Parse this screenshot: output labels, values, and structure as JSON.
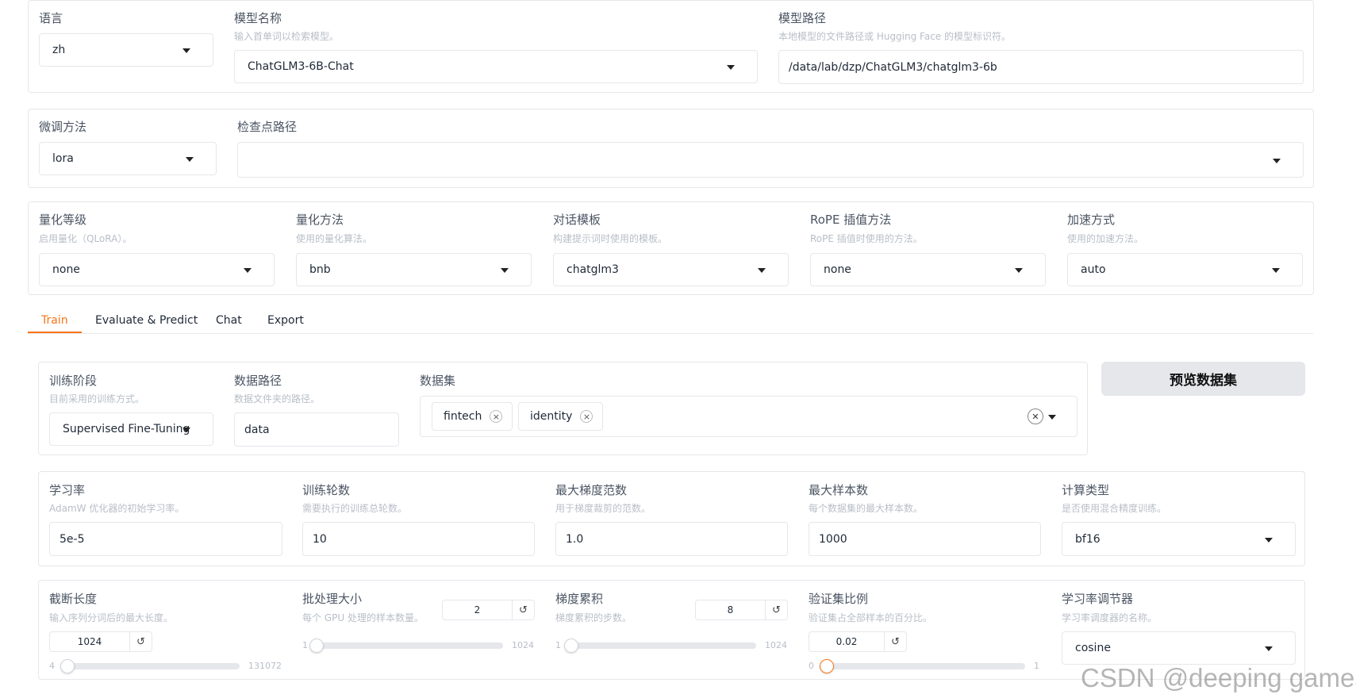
{
  "top": {
    "lang": {
      "label": "语言",
      "value": "zh"
    },
    "model_name": {
      "label": "模型名称",
      "info": "输入首单词以检索模型。",
      "value": "ChatGLM3-6B-Chat"
    },
    "model_path": {
      "label": "模型路径",
      "info": "本地模型的文件路径或 Hugging Face 的模型标识符。",
      "value": "/data/lab/dzp/ChatGLM3/chatglm3-6b"
    }
  },
  "finetune": {
    "method": {
      "label": "微调方法",
      "value": "lora"
    },
    "checkpoint": {
      "label": "检查点路径",
      "value": ""
    }
  },
  "advanced": {
    "quant_bit": {
      "label": "量化等级",
      "info": "启用量化（QLoRA）。",
      "value": "none"
    },
    "quant_method": {
      "label": "量化方法",
      "info": "使用的量化算法。",
      "value": "bnb"
    },
    "template": {
      "label": "对话模板",
      "info": "构建提示词时使用的模板。",
      "value": "chatglm3"
    },
    "rope": {
      "label": "RoPE 插值方法",
      "info": "RoPE 插值时使用的方法。",
      "value": "none"
    },
    "booster": {
      "label": "加速方式",
      "info": "使用的加速方法。",
      "value": "auto"
    }
  },
  "tabs": [
    "Train",
    "Evaluate & Predict",
    "Chat",
    "Export"
  ],
  "active_tab": "Train",
  "accent_color": "#f97316",
  "train": {
    "stage": {
      "label": "训练阶段",
      "info": "目前采用的训练方式。",
      "value": "Supervised Fine-Tuning"
    },
    "dataset_dir": {
      "label": "数据路径",
      "info": "数据文件夹的路径。",
      "value": "data"
    },
    "dataset": {
      "label": "数据集",
      "chips": [
        "fintech",
        "identity"
      ]
    },
    "preview_button": "预览数据集",
    "learning_rate": {
      "label": "学习率",
      "info": "AdamW 优化器的初始学习率。",
      "value": "5e-5"
    },
    "epochs": {
      "label": "训练轮数",
      "info": "需要执行的训练总轮数。",
      "value": "10"
    },
    "max_grad_norm": {
      "label": "最大梯度范数",
      "info": "用于梯度裁剪的范数。",
      "value": "1.0"
    },
    "max_samples": {
      "label": "最大样本数",
      "info": "每个数据集的最大样本数。",
      "value": "1000"
    },
    "compute_type": {
      "label": "计算类型",
      "info": "是否使用混合精度训练。",
      "value": "bf16"
    },
    "cutoff_len": {
      "label": "截断长度",
      "info": "输入序列分词后的最大长度。",
      "value": "1024",
      "min": "4",
      "max": "131072",
      "fraction": 0.008
    },
    "batch_size": {
      "label": "批处理大小",
      "info": "每个 GPU 处理的样本数量。",
      "value": "2",
      "min": "1",
      "max": "1024",
      "fraction": 0.001
    },
    "grad_accum": {
      "label": "梯度累积",
      "info": "梯度累积的步数。",
      "value": "8",
      "min": "1",
      "max": "1024",
      "fraction": 0.007
    },
    "val_size": {
      "label": "验证集比例",
      "info": "验证集占全部样本的百分比。",
      "value": "0.02",
      "min": "0",
      "max": "1",
      "fraction": 0.02
    },
    "lr_scheduler": {
      "label": "学习率调节器",
      "info": "学习率调度器的名称。",
      "value": "cosine"
    }
  },
  "icons": {
    "reset": "↺",
    "remove": "×",
    "clear": "✕"
  },
  "watermark": "CSDN @deeping games"
}
